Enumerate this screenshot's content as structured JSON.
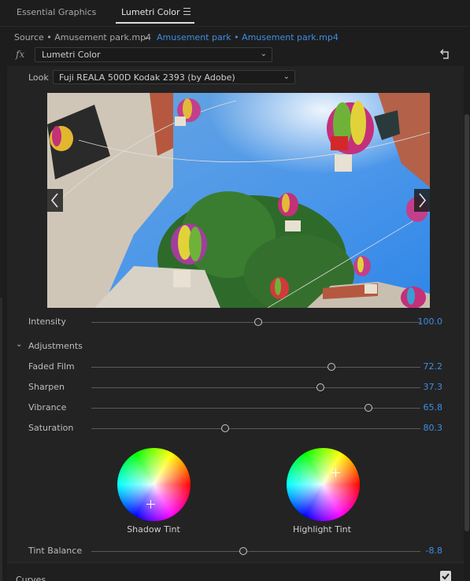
{
  "tabs": [
    {
      "label": "Essential Graphics"
    },
    {
      "label": "Lumetri Color"
    }
  ],
  "source": {
    "master_label": "Source • Amusement park.mp4",
    "sequence_label": "Amusement park • Amusement park.mp4"
  },
  "fx": {
    "icon": "fx",
    "effect_select": "Lumetri Color"
  },
  "look": {
    "label": "Look",
    "value": "Fuji REALA 500D Kodak 2393 (by Adobe)"
  },
  "intensity": {
    "label": "Intensity",
    "value": "100.0",
    "fraction": 0.507
  },
  "adjustments": {
    "section_label": "Adjustments",
    "sliders": [
      {
        "label": "Faded Film",
        "value": "72.2",
        "fraction": 0.73
      },
      {
        "label": "Sharpen",
        "value": "37.3",
        "fraction": 0.695
      },
      {
        "label": "Vibrance",
        "value": "65.8",
        "fraction": 0.842
      },
      {
        "label": "Saturation",
        "value": "80.3",
        "fraction": 0.407
      }
    ],
    "wheels": [
      {
        "label": "Shadow Tint"
      },
      {
        "label": "Highlight Tint"
      }
    ],
    "tint_balance": {
      "label": "Tint Balance",
      "value": "-8.8",
      "fraction": 0.462
    }
  },
  "curves": {
    "label": "Curves",
    "checked": true
  },
  "colors": {
    "accent": "#3d8ee6",
    "panel": "#232323",
    "background": "#1d1d1d"
  }
}
